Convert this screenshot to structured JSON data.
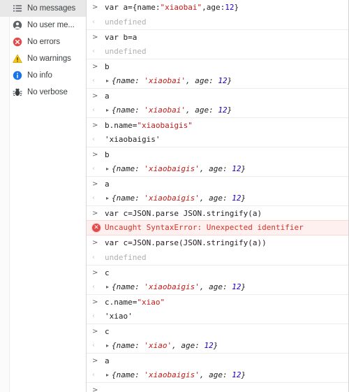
{
  "sidebar": {
    "items": [
      {
        "icon": "list-icon",
        "label": "No messages",
        "selected": true
      },
      {
        "icon": "user-icon",
        "label": "No user me...",
        "selected": false
      },
      {
        "icon": "error-icon",
        "label": "No errors",
        "selected": false
      },
      {
        "icon": "warning-icon",
        "label": "No warnings",
        "selected": false
      },
      {
        "icon": "info-icon",
        "label": "No info",
        "selected": false
      },
      {
        "icon": "bug-icon",
        "label": "No verbose",
        "selected": false
      }
    ]
  },
  "console": {
    "input_marker": ">",
    "output_marker": "‹",
    "disclosure_marker": "▸",
    "error_icon_glyph": "✕",
    "colors": {
      "string": "#c41a16",
      "number": "#1c00cf",
      "error": "#d93025",
      "error_background": "#fff0f0",
      "muted": "#b0b0b0"
    },
    "rows": [
      {
        "kind": "input",
        "separator": false,
        "parts": [
          {
            "t": "var a={name:",
            "c": "plain"
          },
          {
            "t": "\"xiaobai\"",
            "c": "str"
          },
          {
            "t": ",age:",
            "c": "plain"
          },
          {
            "t": "12",
            "c": "num"
          },
          {
            "t": "}",
            "c": "plain"
          }
        ]
      },
      {
        "kind": "muted",
        "separator": false,
        "text": "undefined"
      },
      {
        "kind": "input",
        "separator": true,
        "parts": [
          {
            "t": "var b=a",
            "c": "plain"
          }
        ]
      },
      {
        "kind": "muted",
        "separator": false,
        "text": "undefined"
      },
      {
        "kind": "input",
        "separator": true,
        "parts": [
          {
            "t": "b",
            "c": "plain"
          }
        ]
      },
      {
        "kind": "object",
        "separator": false,
        "parts": [
          {
            "t": "{name: ",
            "c": "plain"
          },
          {
            "t": "'xiaobai'",
            "c": "str"
          },
          {
            "t": ", age: ",
            "c": "plain"
          },
          {
            "t": "12",
            "c": "num"
          },
          {
            "t": "}",
            "c": "plain"
          }
        ]
      },
      {
        "kind": "input",
        "separator": true,
        "parts": [
          {
            "t": "a",
            "c": "plain"
          }
        ]
      },
      {
        "kind": "object",
        "separator": false,
        "parts": [
          {
            "t": "{name: ",
            "c": "plain"
          },
          {
            "t": "'xiaobai'",
            "c": "str"
          },
          {
            "t": ", age: ",
            "c": "plain"
          },
          {
            "t": "12",
            "c": "num"
          },
          {
            "t": "}",
            "c": "plain"
          }
        ]
      },
      {
        "kind": "input",
        "separator": true,
        "parts": [
          {
            "t": "b.name=",
            "c": "plain"
          },
          {
            "t": "\"xiaobaigis\"",
            "c": "str"
          }
        ]
      },
      {
        "kind": "strres",
        "separator": false,
        "text": "'xiaobaigis'"
      },
      {
        "kind": "input",
        "separator": true,
        "parts": [
          {
            "t": "b",
            "c": "plain"
          }
        ]
      },
      {
        "kind": "object",
        "separator": false,
        "parts": [
          {
            "t": "{name: ",
            "c": "plain"
          },
          {
            "t": "'xiaobaigis'",
            "c": "str"
          },
          {
            "t": ", age: ",
            "c": "plain"
          },
          {
            "t": "12",
            "c": "num"
          },
          {
            "t": "}",
            "c": "plain"
          }
        ]
      },
      {
        "kind": "input",
        "separator": true,
        "parts": [
          {
            "t": "a",
            "c": "plain"
          }
        ]
      },
      {
        "kind": "object",
        "separator": false,
        "parts": [
          {
            "t": "{name: ",
            "c": "plain"
          },
          {
            "t": "'xiaobaigis'",
            "c": "str"
          },
          {
            "t": ", age: ",
            "c": "plain"
          },
          {
            "t": "12",
            "c": "num"
          },
          {
            "t": "}",
            "c": "plain"
          }
        ]
      },
      {
        "kind": "input",
        "separator": true,
        "parts": [
          {
            "t": "var c=JSON.parse JSON.stringify(a)",
            "c": "plain"
          }
        ]
      },
      {
        "kind": "error",
        "separator": false,
        "text": "Uncaught SyntaxError: Unexpected identifier"
      },
      {
        "kind": "input",
        "separator": false,
        "parts": [
          {
            "t": "var c=JSON.parse(JSON.stringify(a))",
            "c": "plain"
          }
        ]
      },
      {
        "kind": "muted",
        "separator": false,
        "text": "undefined"
      },
      {
        "kind": "input",
        "separator": true,
        "parts": [
          {
            "t": "c",
            "c": "plain"
          }
        ]
      },
      {
        "kind": "object",
        "separator": false,
        "parts": [
          {
            "t": "{name: ",
            "c": "plain"
          },
          {
            "t": "'xiaobaigis'",
            "c": "str"
          },
          {
            "t": ", age: ",
            "c": "plain"
          },
          {
            "t": "12",
            "c": "num"
          },
          {
            "t": "}",
            "c": "plain"
          }
        ]
      },
      {
        "kind": "input",
        "separator": true,
        "parts": [
          {
            "t": "c.name=",
            "c": "plain"
          },
          {
            "t": "\"xiao\"",
            "c": "str"
          }
        ]
      },
      {
        "kind": "strres",
        "separator": false,
        "text": "'xiao'"
      },
      {
        "kind": "input",
        "separator": true,
        "parts": [
          {
            "t": "c",
            "c": "plain"
          }
        ]
      },
      {
        "kind": "object",
        "separator": false,
        "parts": [
          {
            "t": "{name: ",
            "c": "plain"
          },
          {
            "t": "'xiao'",
            "c": "str"
          },
          {
            "t": ", age: ",
            "c": "plain"
          },
          {
            "t": "12",
            "c": "num"
          },
          {
            "t": "}",
            "c": "plain"
          }
        ]
      },
      {
        "kind": "input",
        "separator": true,
        "parts": [
          {
            "t": "a",
            "c": "plain"
          }
        ]
      },
      {
        "kind": "object",
        "separator": false,
        "parts": [
          {
            "t": "{name: ",
            "c": "plain"
          },
          {
            "t": "'xiaobaigis'",
            "c": "str"
          },
          {
            "t": ", age: ",
            "c": "plain"
          },
          {
            "t": "12",
            "c": "num"
          },
          {
            "t": "}",
            "c": "plain"
          }
        ]
      },
      {
        "kind": "prompt",
        "separator": true,
        "parts": []
      }
    ]
  }
}
